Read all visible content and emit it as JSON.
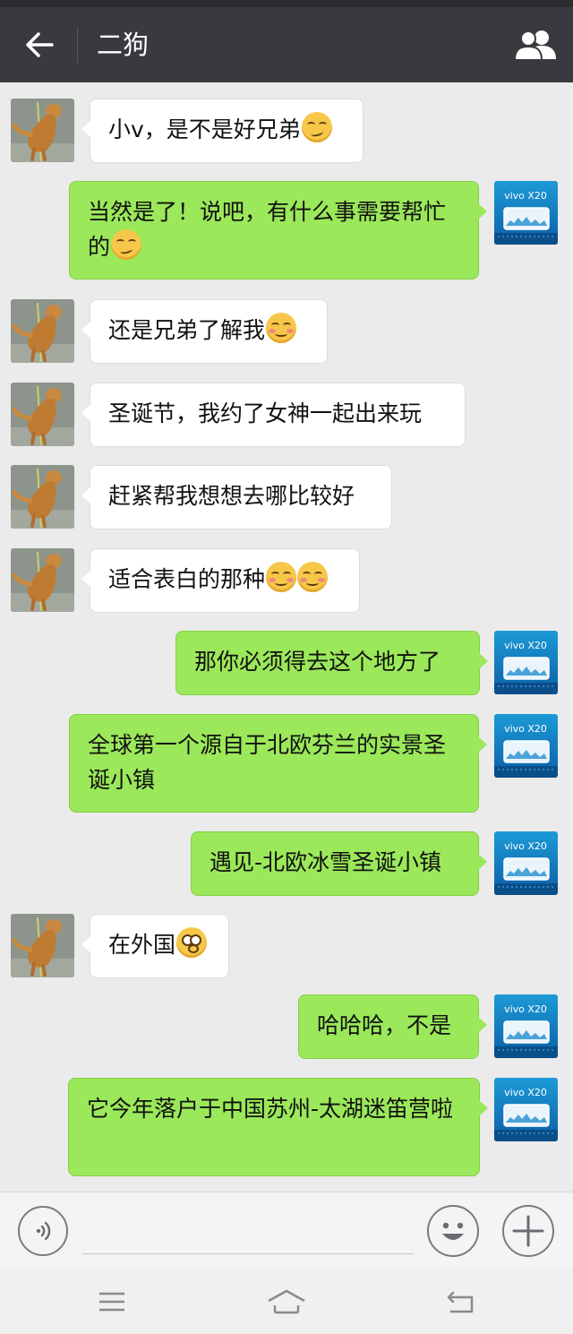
{
  "header": {
    "title": "二狗",
    "back_icon": "arrow-left-icon",
    "contact_icon": "people-icon",
    "bar_color": "#393a3f"
  },
  "self_avatar_text": "vivo X20",
  "messages": [
    {
      "side": "left",
      "text": "小v，是不是好兄弟",
      "emojis": [
        "smirk"
      ]
    },
    {
      "side": "right",
      "text": "当然是了！说吧，有什么事需要帮忙的",
      "emojis": [
        "smirk"
      ]
    },
    {
      "side": "left",
      "text": "还是兄弟了解我",
      "emojis": [
        "blush"
      ]
    },
    {
      "side": "left",
      "text": "圣诞节，我约了女神一起出来玩",
      "emojis": []
    },
    {
      "side": "left",
      "text": "赶紧帮我想想去哪比较好",
      "emojis": []
    },
    {
      "side": "left",
      "text": "适合表白的那种",
      "emojis": [
        "blush",
        "blush"
      ]
    },
    {
      "side": "right",
      "text": "那你必须得去这个地方了",
      "emojis": []
    },
    {
      "side": "right",
      "text": "全球第一个源自于北欧芬兰的实景圣诞小镇",
      "emojis": []
    },
    {
      "side": "right",
      "text": "遇见-北欧冰雪圣诞小镇",
      "emojis": []
    },
    {
      "side": "left",
      "text": "在外国",
      "emojis": [
        "flushed"
      ]
    },
    {
      "side": "right",
      "text": "哈哈哈，不是",
      "emojis": []
    },
    {
      "side": "right",
      "text": "它今年落户于中国苏州-太湖迷笛营啦",
      "emojis": []
    }
  ],
  "input": {
    "value": "",
    "voice_icon": "voice-icon",
    "emoji_icon": "emoji-icon",
    "plus_icon": "plus-icon"
  },
  "nav": {
    "menu_icon": "menu-icon",
    "home_icon": "home-icon",
    "back_icon": "back-icon"
  },
  "colors": {
    "bubble_self": "#9be85a",
    "bubble_other": "#ffffff",
    "background": "#ebebeb"
  }
}
